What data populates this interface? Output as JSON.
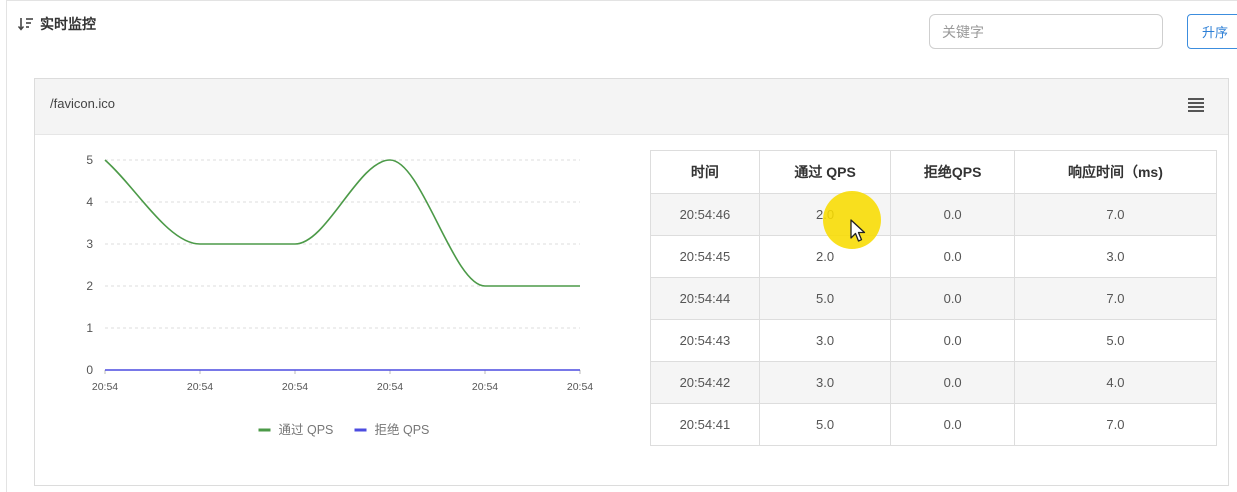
{
  "header": {
    "title": "实时监控",
    "search_placeholder": "关键字",
    "sort_button": "升序"
  },
  "panel": {
    "title": "/favicon.ico"
  },
  "chart_data": {
    "type": "line",
    "x": [
      "20:54:41",
      "20:54:42",
      "20:54:43",
      "20:54:44",
      "20:54:45",
      "20:54:46"
    ],
    "x_tick_labels": [
      "20:54",
      "20:54",
      "20:54",
      "20:54",
      "20:54",
      "20:54"
    ],
    "series": [
      {
        "name": "通过 QPS",
        "values": [
          5,
          3,
          3,
          5,
          2,
          2
        ],
        "color": "#4c9a48"
      },
      {
        "name": "拒绝 QPS",
        "values": [
          0,
          0,
          0,
          0,
          0,
          0
        ],
        "color": "#4c4ce0"
      }
    ],
    "ylim": [
      0,
      5
    ],
    "yticks": [
      "0",
      "1",
      "2",
      "3",
      "4",
      "5"
    ],
    "grid": true,
    "legend_position": "bottom"
  },
  "table": {
    "columns": [
      "时间",
      "通过 QPS",
      "拒绝QPS",
      "响应时间（ms)"
    ],
    "rows": [
      [
        "20:54:46",
        "2.0",
        "0.0",
        "7.0"
      ],
      [
        "20:54:45",
        "2.0",
        "0.0",
        "3.0"
      ],
      [
        "20:54:44",
        "5.0",
        "0.0",
        "7.0"
      ],
      [
        "20:54:43",
        "3.0",
        "0.0",
        "5.0"
      ],
      [
        "20:54:42",
        "3.0",
        "0.0",
        "4.0"
      ],
      [
        "20:54:41",
        "5.0",
        "0.0",
        "7.0"
      ]
    ]
  }
}
